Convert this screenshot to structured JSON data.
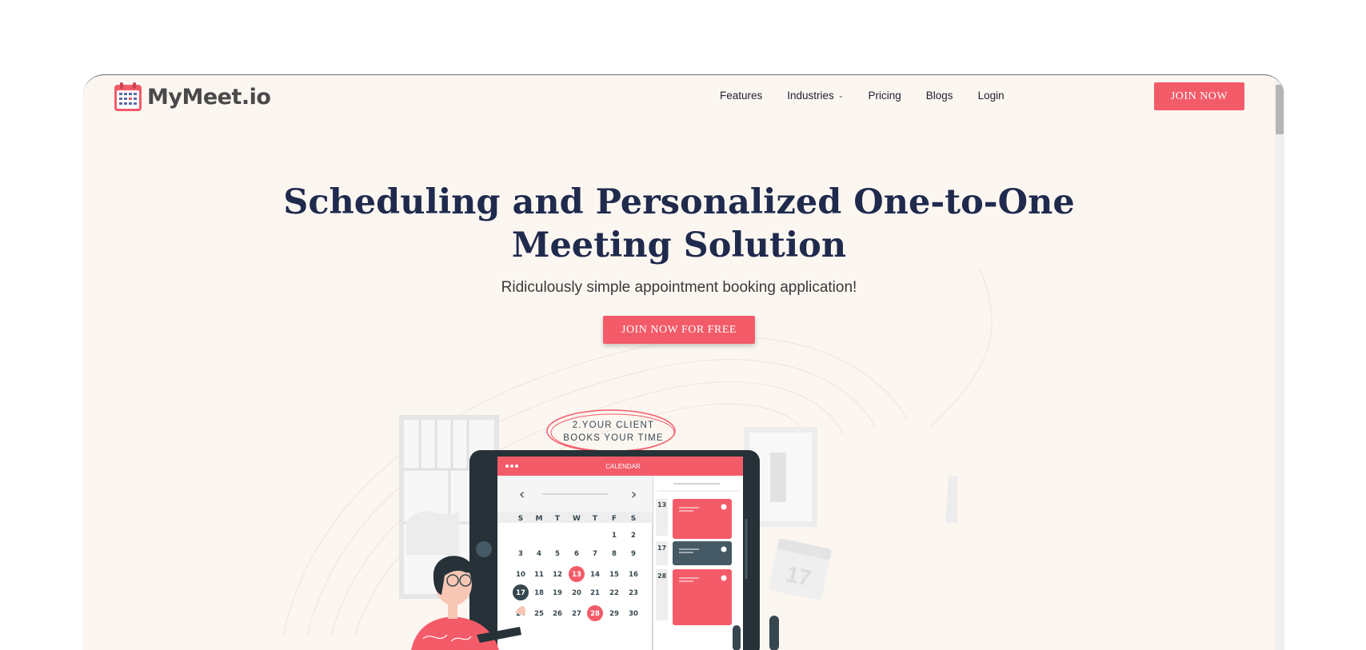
{
  "brand": {
    "name": "MyMeet.io",
    "logo_icon": "calendar-icon"
  },
  "nav": {
    "items": [
      {
        "label": "Features",
        "has_dropdown": false
      },
      {
        "label": "Industries",
        "has_dropdown": true
      },
      {
        "label": "Pricing",
        "has_dropdown": false
      },
      {
        "label": "Blogs",
        "has_dropdown": false
      },
      {
        "label": "Login",
        "has_dropdown": false
      }
    ],
    "cta_label": "JOIN NOW"
  },
  "hero": {
    "title_line1": "Scheduling and Personalized One-to-One",
    "title_line2": "Meeting Solution",
    "subtitle": "Ridiculously simple appointment booking application!",
    "cta_label": "JOIN NOW FOR FREE"
  },
  "illustration": {
    "callout_line1": "2.YOUR CLIENT",
    "callout_line2": "BOOKS YOUR TIME",
    "calendar_header": "CALENDAR",
    "weekdays": [
      "S",
      "M",
      "T",
      "W",
      "T",
      "F",
      "S"
    ],
    "weeks": [
      [
        "",
        "",
        "",
        "",
        "",
        "1",
        "2"
      ],
      [
        "3",
        "4",
        "5",
        "6",
        "7",
        "8",
        "9"
      ],
      [
        "10",
        "11",
        "12",
        "13",
        "14",
        "15",
        "16"
      ],
      [
        "17",
        "18",
        "19",
        "20",
        "21",
        "22",
        "23"
      ],
      [
        "24",
        "25",
        "26",
        "27",
        "28",
        "29",
        "30"
      ]
    ],
    "highlighted_days": [
      "13",
      "28"
    ],
    "selected_day": "17",
    "side_dates": [
      "13",
      "17",
      "28"
    ],
    "wall_calendar_day": "17"
  },
  "colors": {
    "accent": "#f45b69",
    "navy": "#1f2a4d",
    "background": "#fcf6f1",
    "dark": "#37474f"
  }
}
